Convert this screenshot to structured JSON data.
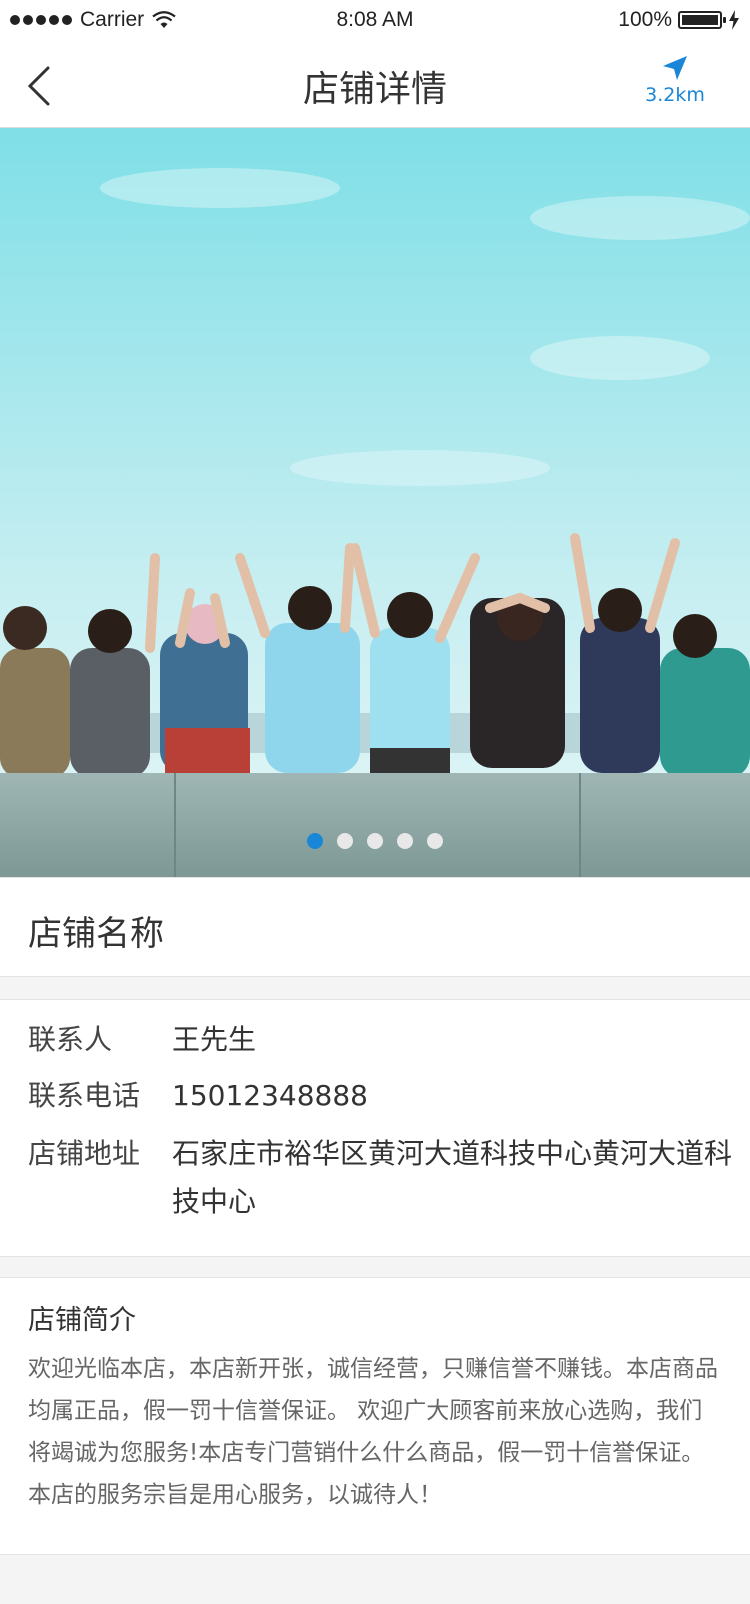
{
  "status_bar": {
    "carrier": "Carrier",
    "time": "8:08 AM",
    "battery": "100%"
  },
  "nav": {
    "title": "店铺详情",
    "distance": "3.2km",
    "accent": "#1a86d8"
  },
  "banner": {
    "slides": 5,
    "active_index": 0,
    "image_description": "photo"
  },
  "shop": {
    "name": "店铺名称"
  },
  "info": {
    "contact_label": "联系人",
    "contact_value": "王先生",
    "phone_label": "联系电话",
    "phone_value": "15012348888",
    "address_label": "店铺地址",
    "address_value": "石家庄市裕华区黄河大道科技中心黄河大道科技中心"
  },
  "intro": {
    "title": "店铺简介",
    "text": "欢迎光临本店，本店新开张，诚信经营，只赚信誉不赚钱。本店商品均属正品，假一罚十信誉保证。 欢迎广大顾客前来放心选购，我们将竭诚为您服务!本店专门营销什么什么商品，假一罚十信誉保证。本店的服务宗旨是用心服务，以诚待人！"
  }
}
